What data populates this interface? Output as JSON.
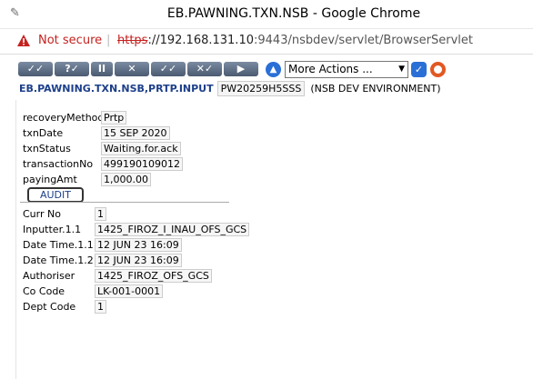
{
  "window": {
    "title": "EB.PAWNING.TXN.NSB - Google Chrome"
  },
  "urlbar": {
    "security": "Not secure",
    "scheme": "https",
    "host": "://192.168.131.10",
    "path": ":9443/nsbdev/servlet/BrowserServlet"
  },
  "toolbar": {
    "buttons": [
      "✓✓",
      "?✓",
      "II",
      "✕",
      "✓✓",
      "✕✓",
      "▶"
    ],
    "actions_selected": "More Actions ...",
    "up_icon": "up-arrow-icon",
    "ok_icon": "check-icon",
    "help_icon": "lifebuoy-icon"
  },
  "app": {
    "name": "EB.PAWNING.TXN.NSB,PRTP.INPUT",
    "txn_id": "PW20259H5SSS",
    "env": "(NSB DEV ENVIRONMENT)"
  },
  "fields": [
    {
      "label": "recoveryMethod",
      "value": "Prtp"
    },
    {
      "label": "txnDate",
      "value": "15 SEP 2020"
    },
    {
      "label": "txnStatus",
      "value": "Waiting.for.ack"
    },
    {
      "label": "transactionNo",
      "value": "499190109012"
    },
    {
      "label": "payingAmt",
      "value": "1,000.00"
    }
  ],
  "audit": {
    "tab_label": "AUDIT",
    "rows": [
      {
        "label": "Curr No",
        "value": "1"
      },
      {
        "label": "Inputter.1.1",
        "value": "1425_FIROZ_I_INAU_OFS_GCS"
      },
      {
        "label": "Date Time.1.1",
        "value": "12 JUN 23 16:09"
      },
      {
        "label": "Date Time.1.2",
        "value": "12 JUN 23 16:09"
      },
      {
        "label": "Authoriser",
        "value": "1425_FIROZ_OFS_GCS"
      },
      {
        "label": "Co Code",
        "value": "LK-001-0001"
      },
      {
        "label": "Dept Code",
        "value": "1"
      }
    ]
  }
}
